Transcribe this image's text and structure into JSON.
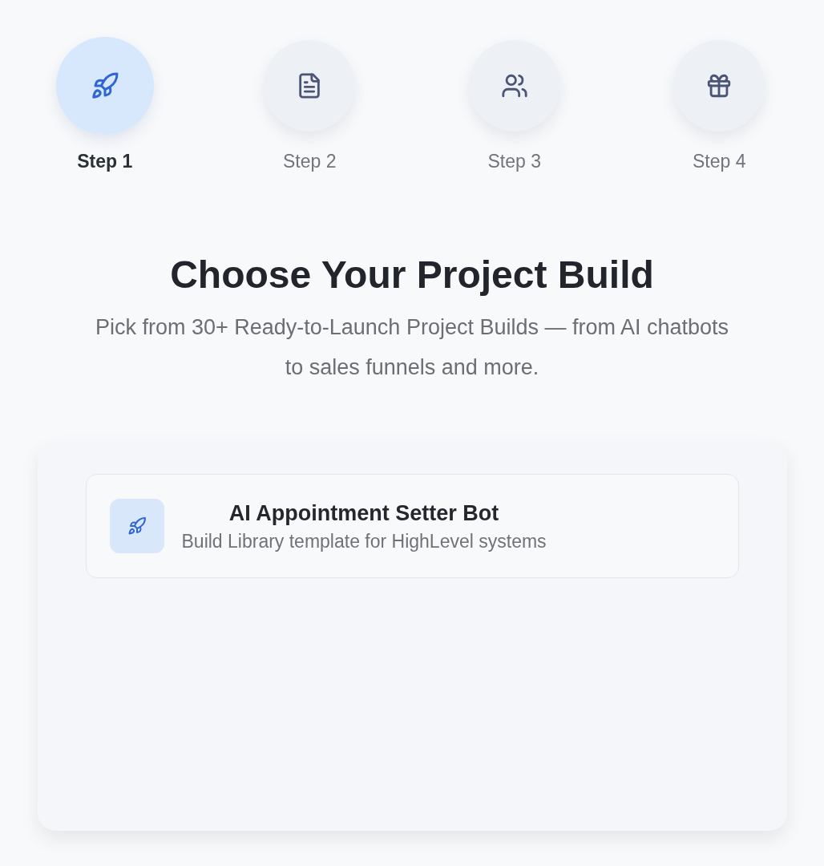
{
  "steps": [
    {
      "label": "Step 1",
      "selected": true
    },
    {
      "label": "Step 2",
      "selected": false
    },
    {
      "label": "Step 3",
      "selected": false
    },
    {
      "label": "Step 4",
      "selected": false
    }
  ],
  "heading": "Choose Your Project Build",
  "subheading": "Pick from 30+ Ready-to-Launch Project Builds — from AI chatbots to sales funnels and more.",
  "builds": [
    {
      "title": "AI Appointment Setter Bot",
      "description": "Build Library template for HighLevel systems"
    }
  ]
}
